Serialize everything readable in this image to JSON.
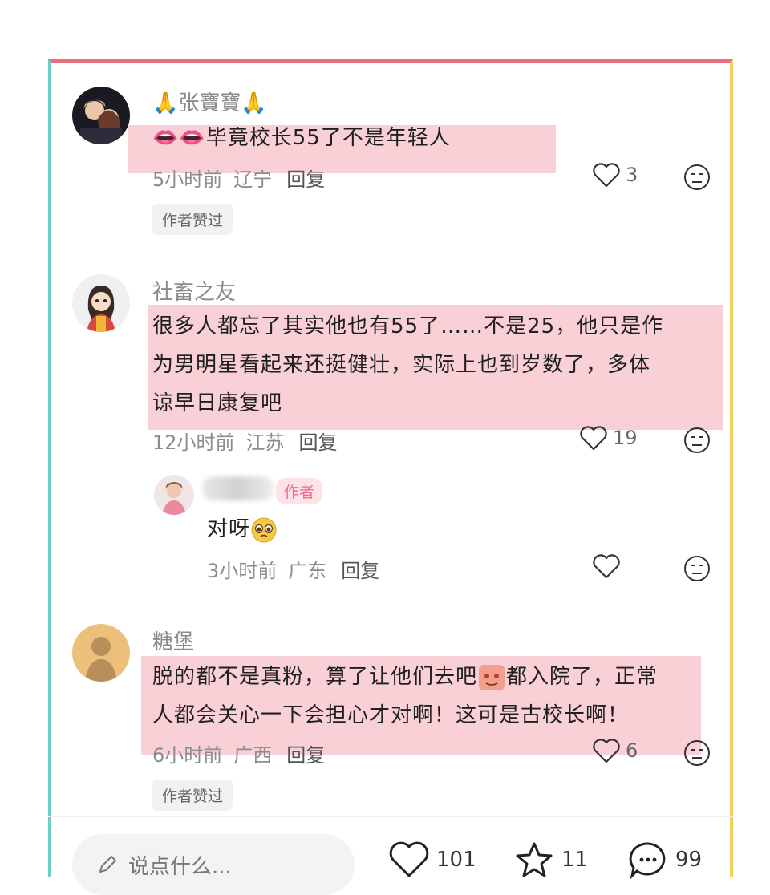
{
  "comments": [
    {
      "user": "张寶寶",
      "body": "毕竟校长55了不是年轻人",
      "time": "5小时前",
      "location": "辽宁",
      "reply": "回复",
      "likes": "3",
      "tag": "作者赞过"
    },
    {
      "user": "社畜之友",
      "body_lines": [
        "很多人都忘了其实他也有55了……不是25，他只是作",
        "为男明星看起来还挺健壮，实际上也到岁数了，多体",
        "谅早日康复吧"
      ],
      "time": "12小时前",
      "location": "江苏",
      "reply": "回复",
      "likes": "19",
      "sub_reply": {
        "badge": "作者",
        "body": "对呀",
        "time": "3小时前",
        "location": "广东",
        "reply": "回复"
      }
    },
    {
      "user": "糖堡",
      "body_lines": [
        "脱的都不是真粉，算了让他们去吧",
        "都入院了，正常",
        "人都会关心一下会担心才对啊！这可是古校长啊！"
      ],
      "time": "6小时前",
      "location": "广西",
      "reply": "回复",
      "likes": "6",
      "tag": "作者赞过"
    }
  ],
  "footer": {
    "input_placeholder": "说点什么...",
    "likes": "101",
    "stars": "11",
    "comments": "99"
  },
  "colors": {
    "highlight": "#f7c8cf",
    "border_top": "#e8707e",
    "border_left": "#6ecfc9",
    "border_right": "#f2cf5b"
  }
}
